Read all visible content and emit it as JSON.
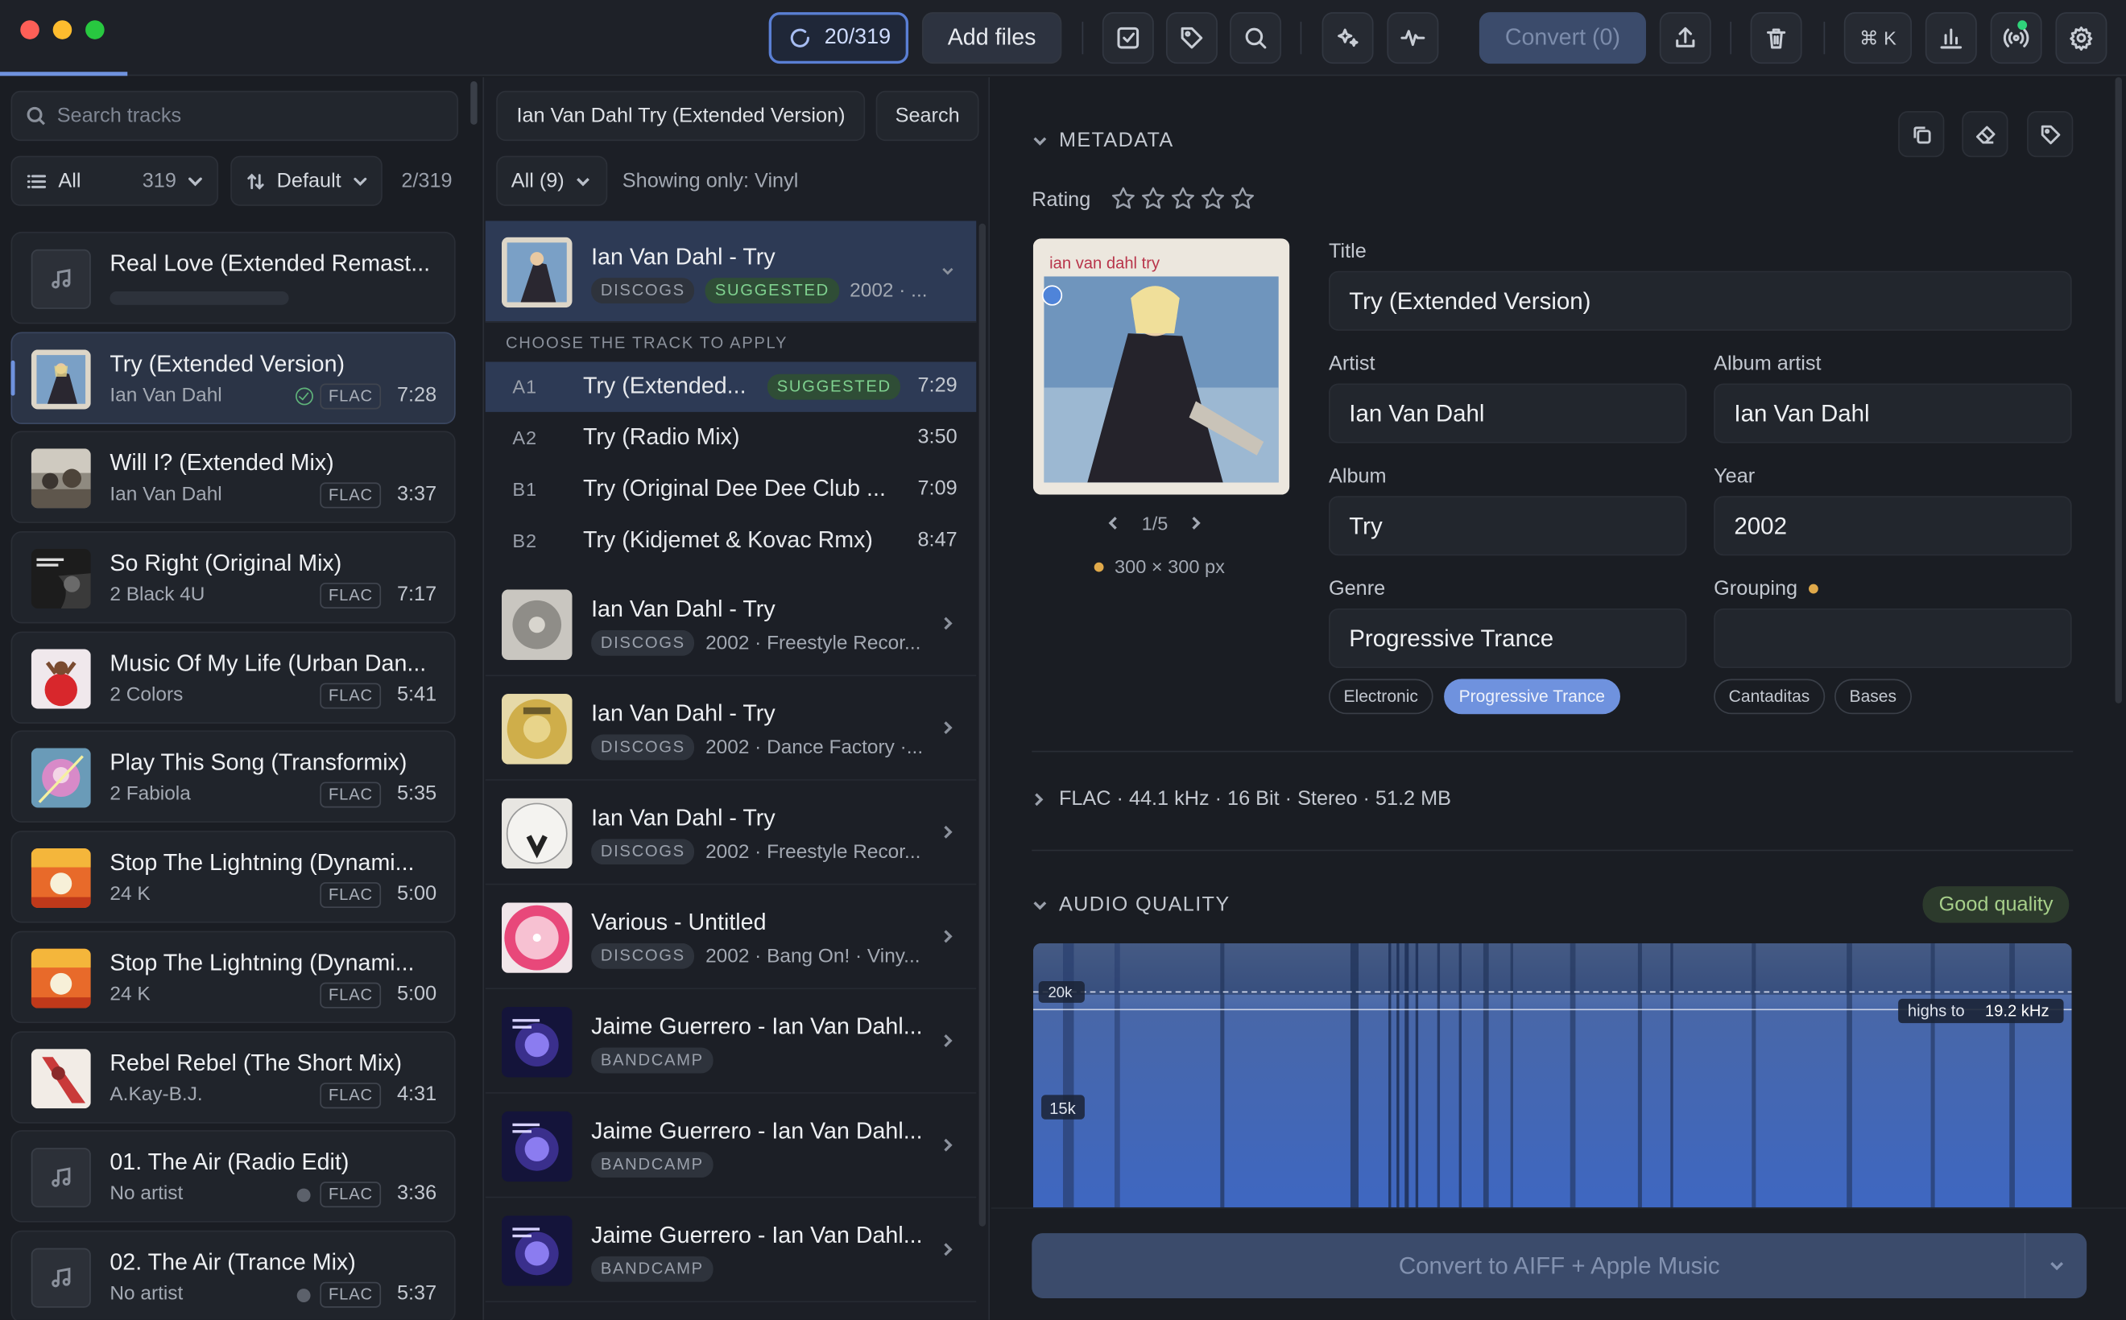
{
  "toolbar": {
    "progress": "20/319",
    "add_files": "Add files",
    "convert": "Convert (0)",
    "shortcut": "⌘ K"
  },
  "library": {
    "search_placeholder": "Search tracks",
    "filter": {
      "label": "All",
      "count": "319"
    },
    "sort": {
      "label": "Default"
    },
    "page": "2/319",
    "tracks": [
      {
        "title": "Real Love (Extended Remast...",
        "artist": "",
        "format": "",
        "duration": "",
        "status": "loading"
      },
      {
        "title": "Try (Extended Version)",
        "artist": "Ian Van Dahl",
        "format": "FLAC",
        "duration": "7:28",
        "status": "done"
      },
      {
        "title": "Will I? (Extended Mix)",
        "artist": "Ian Van Dahl",
        "format": "FLAC",
        "duration": "3:37"
      },
      {
        "title": "So Right (Original Mix)",
        "artist": "2 Black 4U",
        "format": "FLAC",
        "duration": "7:17"
      },
      {
        "title": "Music Of My Life (Urban Dan...",
        "artist": "2 Colors",
        "format": "FLAC",
        "duration": "5:41"
      },
      {
        "title": "Play This Song (Transformix)",
        "artist": "2 Fabiola",
        "format": "FLAC",
        "duration": "5:35"
      },
      {
        "title": "Stop The Lightning (Dynami...",
        "artist": "24 K",
        "format": "FLAC",
        "duration": "5:00"
      },
      {
        "title": "Stop The Lightning (Dynami...",
        "artist": "24 K",
        "format": "FLAC",
        "duration": "5:00"
      },
      {
        "title": "Rebel Rebel (The Short Mix)",
        "artist": "A.Kay-B.J.",
        "format": "FLAC",
        "duration": "4:31"
      },
      {
        "title": "01. The Air (Radio Edit)",
        "artist": "No artist",
        "format": "FLAC",
        "duration": "3:36"
      },
      {
        "title": "02. The Air (Trance Mix)",
        "artist": "No artist",
        "format": "FLAC",
        "duration": "5:37"
      }
    ]
  },
  "lookup": {
    "query": "Ian Van Dahl Try (Extended Version)",
    "search_button": "Search",
    "filter": "All (9)",
    "showing": "Showing only: Vinyl",
    "choose_label": "CHOOSE THE TRACK TO APPLY",
    "selected_release": {
      "title": "Ian Van Dahl - Try",
      "source": "DISCOGS",
      "badge": "SUGGESTED",
      "meta": "2002 · ..."
    },
    "subtracks": [
      {
        "pos": "A1",
        "title": "Try (Extended...",
        "badge": "SUGGESTED",
        "duration": "7:29"
      },
      {
        "pos": "A2",
        "title": "Try (Radio Mix)",
        "duration": "3:50"
      },
      {
        "pos": "B1",
        "title": "Try (Original Dee Dee Club ...",
        "duration": "7:09"
      },
      {
        "pos": "B2",
        "title": "Try (Kidjemet & Kovac Rmx)",
        "duration": "8:47"
      }
    ],
    "releases": [
      {
        "title": "Ian Van Dahl - Try",
        "source": "DISCOGS",
        "meta": "2002 · Freestyle Recor..."
      },
      {
        "title": "Ian Van Dahl - Try",
        "source": "DISCOGS",
        "meta": "2002 · Dance Factory ·..."
      },
      {
        "title": "Ian Van Dahl - Try",
        "source": "DISCOGS",
        "meta": "2002 · Freestyle Recor..."
      },
      {
        "title": "Various - Untitled",
        "source": "DISCOGS",
        "meta": "2002 · Bang On! · Viny..."
      },
      {
        "title": "Jaime Guerrero - Ian Van Dahl...",
        "source": "BANDCAMP",
        "meta": ""
      },
      {
        "title": "Jaime Guerrero - Ian Van Dahl...",
        "source": "BANDCAMP",
        "meta": ""
      },
      {
        "title": "Jaime Guerrero - Ian Van Dahl...",
        "source": "BANDCAMP",
        "meta": ""
      }
    ]
  },
  "metadata": {
    "section": "METADATA",
    "rating_label": "Rating",
    "rating_value": 0,
    "cover_text": "ian van dahl try",
    "cover_nav": "1/5",
    "cover_res": "300 × 300 px",
    "fields": {
      "title": {
        "label": "Title",
        "value": "Try (Extended Version)"
      },
      "artist": {
        "label": "Artist",
        "value": "Ian Van Dahl"
      },
      "album_artist": {
        "label": "Album artist",
        "value": "Ian Van Dahl"
      },
      "album": {
        "label": "Album",
        "value": "Try"
      },
      "year": {
        "label": "Year",
        "value": "2002"
      },
      "genre": {
        "label": "Genre",
        "value": "Progressive Trance"
      },
      "grouping": {
        "label": "Grouping",
        "value": ""
      }
    },
    "genre_chips": [
      "Electronic",
      "Progressive Trance"
    ],
    "grouping_chips": [
      "Cantaditas",
      "Bases"
    ],
    "format": "FLAC · 44.1 kHz · 16 Bit · Stereo · 51.2 MB"
  },
  "audio_quality": {
    "section": "AUDIO QUALITY",
    "badge": "Good quality",
    "label_20k": "20k",
    "label_15k": "15k",
    "highs_label": "highs to",
    "highs_value": "19.2 kHz"
  },
  "convert_button": "Convert to AIFF + Apple Music",
  "colors": {
    "accent": "#6f92de",
    "background": "#1a1d23",
    "good": "#a7d08a",
    "suggested": "#7fd18f"
  }
}
